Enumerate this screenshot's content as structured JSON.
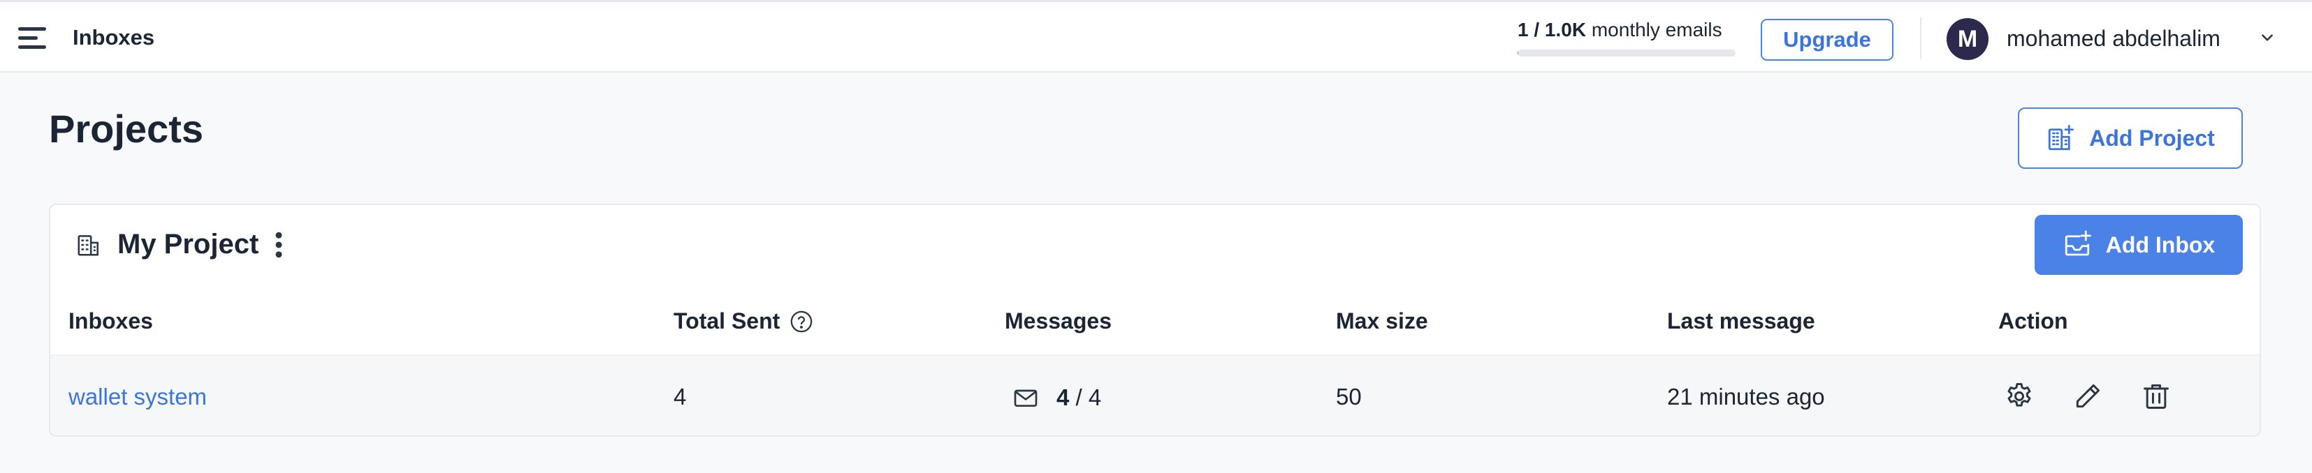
{
  "header": {
    "title": "Inboxes",
    "quota": {
      "used": "1",
      "separator": "/",
      "limit": "1.0K",
      "label": "monthly emails",
      "fill_fraction": 0.001
    },
    "upgrade_label": "Upgrade",
    "user": {
      "initial": "M",
      "name": "mohamed abdelhalim"
    }
  },
  "page": {
    "title": "Projects",
    "add_project_label": "Add Project"
  },
  "project": {
    "name": "My Project",
    "add_inbox_label": "Add Inbox",
    "columns": [
      "Inboxes",
      "Total Sent",
      "Messages",
      "Max size",
      "Last message",
      "Action"
    ],
    "rows": [
      {
        "inbox": "wallet system",
        "total_sent": "4",
        "messages_unread": "4",
        "messages_separator": "/",
        "messages_total": "4",
        "max_size": "50",
        "last_message": "21 minutes ago"
      }
    ]
  },
  "icons": {
    "menu": "hamburger-menu-icon",
    "help": "question-circle-icon",
    "mail": "envelope-icon",
    "settings": "gear-icon",
    "edit": "pencil-icon",
    "delete": "trash-icon",
    "project": "building-icon",
    "chevron": "chevron-down-icon"
  },
  "colors": {
    "accent": "#4a82e8",
    "text": "#1b2534",
    "avatar": "#2b2a4d"
  }
}
